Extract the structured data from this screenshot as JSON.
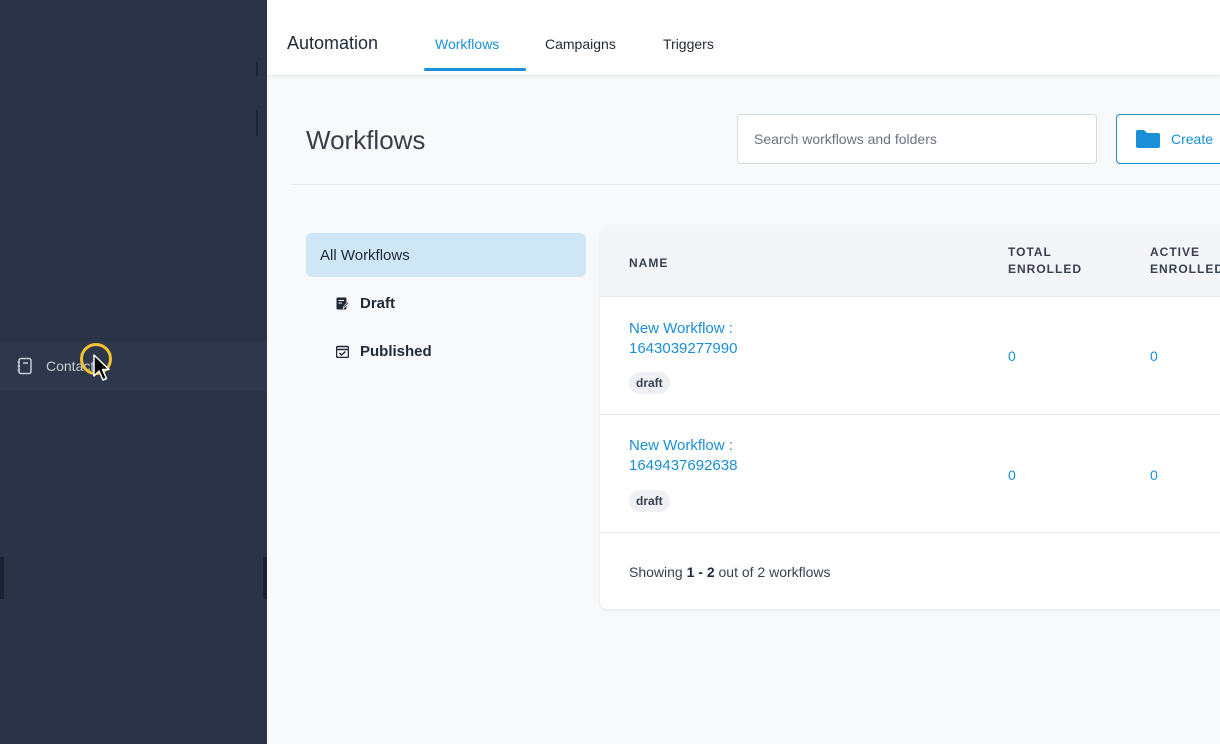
{
  "sidebar": {
    "active_item": {
      "label": "Contacts",
      "icon": "contacts-book-icon"
    }
  },
  "topbar": {
    "app_title": "Automation",
    "tabs": [
      {
        "label": "Workflows",
        "active": true
      },
      {
        "label": "Campaigns",
        "active": false
      },
      {
        "label": "Triggers",
        "active": false
      }
    ]
  },
  "header": {
    "title": "Workflows",
    "search_placeholder": "Search workflows and folders",
    "create_label": "Create",
    "create_icon": "folder-icon"
  },
  "filters": {
    "all": "All Workflows",
    "draft": "Draft",
    "published": "Published"
  },
  "table": {
    "columns": {
      "name": "NAME",
      "total_line1": "TOTAL",
      "total_line2": "ENROLLED",
      "active_line1": "ACTIVE",
      "active_line2": "ENROLLED"
    },
    "rows": [
      {
        "name_line1": "New Workflow :",
        "name_line2": "1643039277990",
        "status": "draft",
        "total_enrolled": "0",
        "active_enrolled": "0"
      },
      {
        "name_line1": "New Workflow :",
        "name_line2": "1649437692638",
        "status": "draft",
        "total_enrolled": "0",
        "active_enrolled": "0"
      }
    ],
    "footer": {
      "prefix": "Showing ",
      "range": "1 - 2",
      "suffix": " out of 2 workflows"
    }
  },
  "colors": {
    "accent": "#1a8fd6",
    "sidebar_bg": "#2b3446",
    "selected_filter_bg": "#cfe6f7"
  }
}
